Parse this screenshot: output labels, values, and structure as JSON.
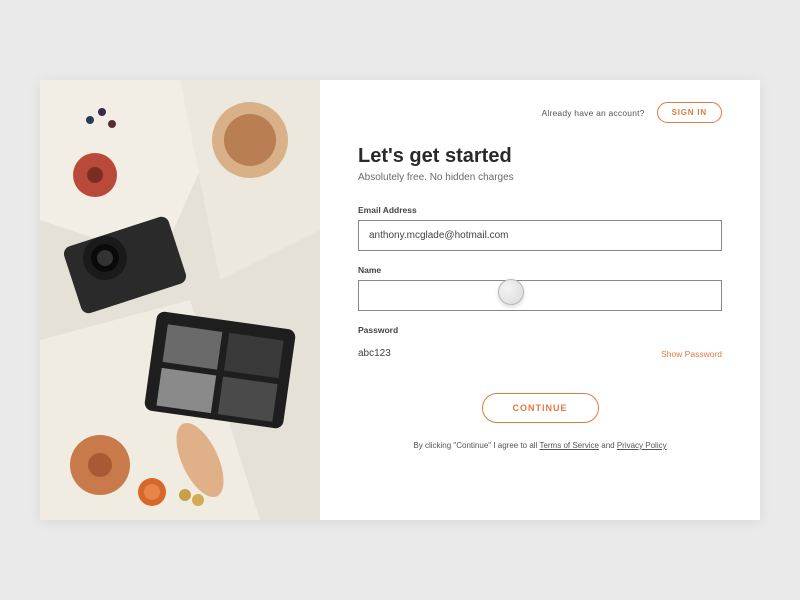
{
  "header": {
    "account_prompt": "Already have an account?",
    "signin_label": "SIGN IN"
  },
  "titles": {
    "heading": "Let's get started",
    "subheading": "Absolutely free. No hidden charges"
  },
  "fields": {
    "email": {
      "label": "Email Address",
      "value": "anthony.mcglade@hotmail.com"
    },
    "name": {
      "label": "Name",
      "value": ""
    },
    "password": {
      "label": "Password",
      "value": "abc123",
      "show_label": "Show Password"
    }
  },
  "actions": {
    "continue_label": "CONTINUE"
  },
  "legal": {
    "prefix": "By clicking \"Continue\" I agree to all ",
    "tos": "Terms of Service",
    "mid": " and ",
    "privacy": "Privacy Policy"
  },
  "colors": {
    "accent": "#e07a3f"
  }
}
